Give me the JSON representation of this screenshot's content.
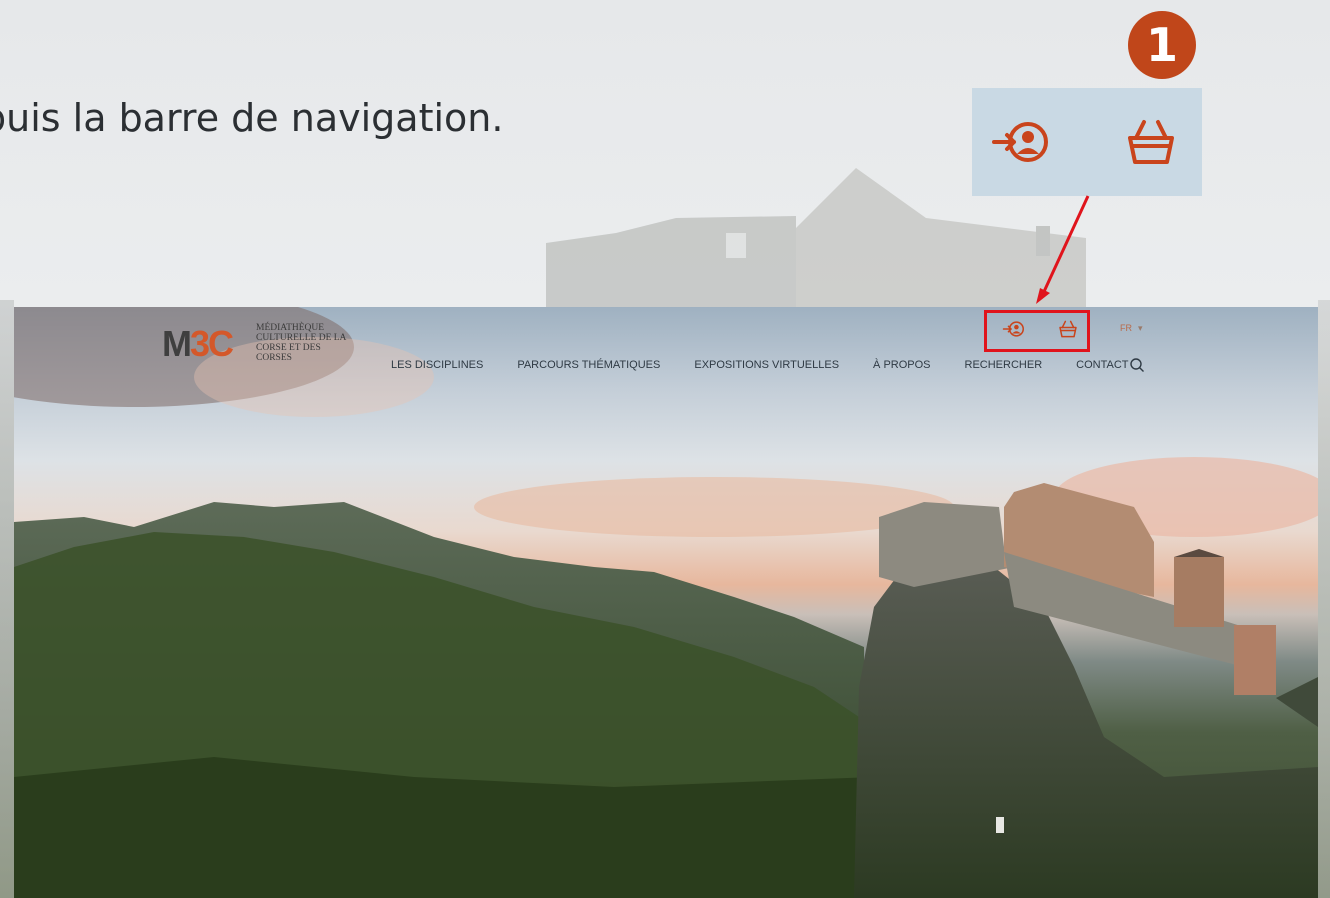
{
  "instruction": {
    "text": "puis la barre de navigation."
  },
  "step_badge": {
    "number": "1"
  },
  "zoom_panel": {
    "icons": [
      "login-icon",
      "cart-icon"
    ]
  },
  "site": {
    "logo": {
      "mark": "M3C",
      "lines": [
        "MÉDIATHÈQUE",
        "CULTURELLE DE LA",
        "CORSE ET DES",
        "CORSES"
      ]
    },
    "utility": {
      "language": "FR",
      "language_caret": "▾"
    },
    "nav": {
      "items": [
        "LES DISCIPLINES",
        "PARCOURS THÉMATIQUES",
        "EXPOSITIONS VIRTUELLES",
        "À PROPOS",
        "RECHERCHER",
        "CONTACT"
      ]
    }
  },
  "colors": {
    "accent": "#c0461a",
    "highlight": "#e0141c",
    "icon": "#c9441c",
    "nav_text": "#2f3a44"
  }
}
